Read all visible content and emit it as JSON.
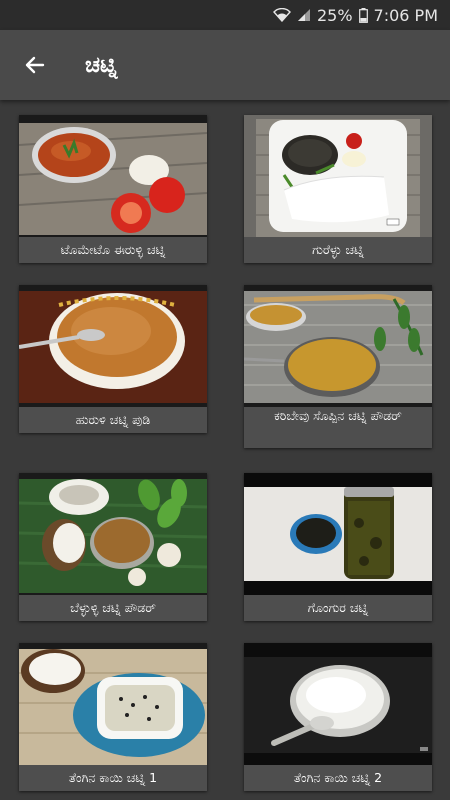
{
  "status_bar": {
    "battery": "25%",
    "time": "7:06 PM",
    "wifi_icon": "wifi-icon",
    "signal_icon": "signal-icon",
    "battery_icon": "battery-icon"
  },
  "app_bar": {
    "title": "ಚಟ್ನಿ",
    "back_icon": "arrow-left-icon"
  },
  "recipes": [
    {
      "title": "ಟೊಮೇಟೊ ಈರುಳ್ಳಿ ಚಟ್ನಿ"
    },
    {
      "title": "ಗುರೆಳ್ಳು ಚಟ್ನಿ"
    },
    {
      "title": "ಹುರುಳಿ ಚಟ್ನಿ ಪುಡಿ"
    },
    {
      "title": "ಕರಿಬೇವು ಸೊಪ್ಪಿನ ಚಟ್ನಿ ಪೌಡರ್"
    },
    {
      "title": "ಬೆಳ್ಳುಳ್ಳಿ ಚಟ್ನಿ ಪೌಡರ್"
    },
    {
      "title": "ಗೊಂಗುರ ಚಟ್ನಿ"
    },
    {
      "title": "ತೆಂಗಿನ ಕಾಯಿ ಚಟ್ನಿ 1"
    },
    {
      "title": "ತೆಂಗಿನ ಕಾಯಿ ಚಟ್ನಿ 2"
    }
  ]
}
